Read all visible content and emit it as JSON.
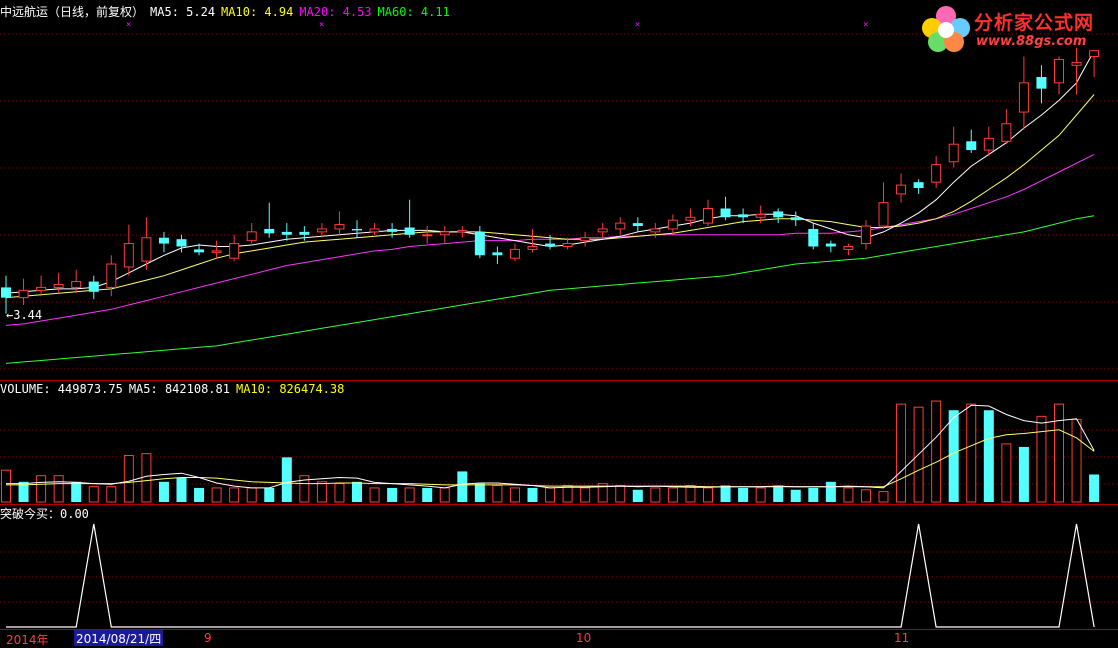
{
  "header": {
    "title": "中远航运（日线，前复权）",
    "ma5": "MA5: 5.24",
    "ma10": "MA10: 4.94",
    "ma20": "MA20: 4.53",
    "ma60": "MA60: 4.11"
  },
  "price_low_marker": "←3.44",
  "volume_header": {
    "volume": "VOLUME: 449873.75",
    "ma5": "MA5: 842108.81",
    "ma10": "MA10: 826474.38"
  },
  "indicator_header": "突破今买：0.00",
  "date_axis": {
    "year": "2014年",
    "selected_date": "2014/08/21/四",
    "month_labels": [
      "9",
      "10",
      "11"
    ]
  },
  "logo": {
    "name": "分析家公式网",
    "url": "www.88gs.com"
  },
  "colors": {
    "up": "#ff3b3b",
    "down": "#54ffff",
    "ma5": "#ffffff",
    "ma10": "#ffff66",
    "ma20": "#ff33ff",
    "ma60": "#33ff33",
    "grid": "#8b0000"
  },
  "chart_data": {
    "type": "candlestick",
    "note_units": "price in CNY, volume in shares",
    "candles": [
      [
        3.62,
        3.55,
        3.7,
        3.44
      ],
      [
        3.55,
        3.6,
        3.68,
        3.5
      ],
      [
        3.6,
        3.62,
        3.7,
        3.56
      ],
      [
        3.62,
        3.64,
        3.72,
        3.58
      ],
      [
        3.62,
        3.66,
        3.74,
        3.58
      ],
      [
        3.66,
        3.59,
        3.7,
        3.54
      ],
      [
        3.62,
        3.78,
        3.84,
        3.56
      ],
      [
        3.76,
        3.92,
        4.05,
        3.7
      ],
      [
        3.8,
        3.96,
        4.1,
        3.74
      ],
      [
        3.96,
        3.92,
        4.0,
        3.86
      ],
      [
        3.95,
        3.9,
        3.98,
        3.86
      ],
      [
        3.88,
        3.86,
        3.92,
        3.84
      ],
      [
        3.86,
        3.87,
        3.94,
        3.82
      ],
      [
        3.82,
        3.92,
        3.98,
        3.8
      ],
      [
        3.94,
        4.0,
        4.06,
        3.92
      ],
      [
        4.02,
        3.99,
        4.2,
        3.96
      ],
      [
        4.0,
        3.98,
        4.06,
        3.94
      ],
      [
        4.0,
        3.98,
        4.04,
        3.94
      ],
      [
        4.0,
        4.02,
        4.06,
        3.96
      ],
      [
        4.02,
        4.05,
        4.14,
        3.98
      ],
      [
        4.02,
        4.01,
        4.08,
        3.96
      ],
      [
        4.0,
        4.02,
        4.06,
        3.98
      ],
      [
        4.02,
        4.0,
        4.06,
        3.96
      ],
      [
        4.03,
        3.98,
        4.22,
        3.96
      ],
      [
        3.98,
        3.98,
        4.04,
        3.92
      ],
      [
        3.98,
        4.0,
        4.04,
        3.92
      ],
      [
        4.0,
        4.01,
        4.04,
        3.96
      ],
      [
        4.0,
        3.84,
        4.04,
        3.82
      ],
      [
        3.86,
        3.84,
        3.9,
        3.78
      ],
      [
        3.82,
        3.88,
        3.92,
        3.8
      ],
      [
        3.88,
        3.9,
        4.02,
        3.86
      ],
      [
        3.92,
        3.9,
        3.98,
        3.88
      ],
      [
        3.9,
        3.92,
        3.96,
        3.88
      ],
      [
        3.94,
        3.96,
        4.0,
        3.9
      ],
      [
        4.0,
        4.02,
        4.06,
        3.96
      ],
      [
        4.02,
        4.06,
        4.1,
        3.98
      ],
      [
        4.06,
        4.04,
        4.1,
        4.0
      ],
      [
        4.0,
        4.02,
        4.06,
        3.96
      ],
      [
        4.02,
        4.08,
        4.12,
        3.98
      ],
      [
        4.08,
        4.1,
        4.16,
        4.04
      ],
      [
        4.06,
        4.16,
        4.22,
        4.04
      ],
      [
        4.16,
        4.1,
        4.24,
        4.08
      ],
      [
        4.12,
        4.1,
        4.16,
        4.06
      ],
      [
        4.1,
        4.12,
        4.18,
        4.06
      ],
      [
        4.14,
        4.1,
        4.16,
        4.06
      ],
      [
        4.1,
        4.08,
        4.14,
        4.04
      ],
      [
        4.02,
        3.9,
        4.06,
        3.88
      ],
      [
        3.92,
        3.9,
        3.94,
        3.86
      ],
      [
        3.88,
        3.9,
        3.92,
        3.84
      ],
      [
        3.92,
        4.04,
        4.08,
        3.88
      ],
      [
        4.04,
        4.2,
        4.34,
        4.02
      ],
      [
        4.26,
        4.32,
        4.4,
        4.2
      ],
      [
        4.34,
        4.3,
        4.36,
        4.26
      ],
      [
        4.34,
        4.46,
        4.52,
        4.3
      ],
      [
        4.48,
        4.6,
        4.72,
        4.44
      ],
      [
        4.62,
        4.56,
        4.7,
        4.54
      ],
      [
        4.56,
        4.64,
        4.72,
        4.52
      ],
      [
        4.62,
        4.74,
        4.84,
        4.6
      ],
      [
        4.82,
        5.02,
        5.2,
        4.7
      ],
      [
        5.06,
        4.98,
        5.14,
        4.88
      ],
      [
        5.02,
        5.18,
        5.2,
        4.94
      ],
      [
        5.14,
        5.16,
        5.26,
        4.94
      ],
      [
        5.2,
        5.24,
        5.24,
        5.06
      ]
    ],
    "ma5": [
      3.58,
      3.59,
      3.6,
      3.61,
      3.61,
      3.62,
      3.66,
      3.72,
      3.78,
      3.84,
      3.89,
      3.91,
      3.9,
      3.9,
      3.91,
      3.93,
      3.95,
      3.96,
      3.97,
      3.98,
      3.99,
      4.0,
      4.01,
      4.01,
      4.01,
      4.0,
      4.0,
      3.98,
      3.96,
      3.94,
      3.92,
      3.9,
      3.91,
      3.93,
      3.95,
      3.97,
      4.0,
      4.02,
      4.04,
      4.06,
      4.09,
      4.11,
      4.11,
      4.12,
      4.12,
      4.11,
      4.06,
      4.02,
      3.98,
      3.96,
      4.0,
      4.06,
      4.13,
      4.22,
      4.34,
      4.45,
      4.53,
      4.61,
      4.71,
      4.8,
      4.9,
      5.02,
      5.24
    ],
    "ma10": [
      3.55,
      3.56,
      3.57,
      3.58,
      3.59,
      3.6,
      3.61,
      3.64,
      3.67,
      3.7,
      3.74,
      3.78,
      3.82,
      3.85,
      3.87,
      3.89,
      3.91,
      3.93,
      3.94,
      3.95,
      3.96,
      3.97,
      3.98,
      3.99,
      4.0,
      4.0,
      4.0,
      4.0,
      3.99,
      3.98,
      3.97,
      3.96,
      3.95,
      3.95,
      3.95,
      3.96,
      3.97,
      3.98,
      3.99,
      4.01,
      4.03,
      4.05,
      4.07,
      4.08,
      4.09,
      4.09,
      4.08,
      4.07,
      4.05,
      4.03,
      4.03,
      4.04,
      4.06,
      4.09,
      4.14,
      4.21,
      4.29,
      4.37,
      4.46,
      4.56,
      4.66,
      4.8,
      4.94
    ],
    "ma20": [
      3.36,
      3.37,
      3.39,
      3.41,
      3.43,
      3.45,
      3.47,
      3.5,
      3.53,
      3.56,
      3.59,
      3.62,
      3.65,
      3.68,
      3.71,
      3.74,
      3.77,
      3.79,
      3.81,
      3.83,
      3.85,
      3.87,
      3.88,
      3.9,
      3.91,
      3.92,
      3.93,
      3.94,
      3.94,
      3.94,
      3.95,
      3.95,
      3.95,
      3.96,
      3.96,
      3.97,
      3.97,
      3.98,
      3.98,
      3.98,
      3.98,
      3.98,
      3.98,
      3.98,
      3.98,
      3.99,
      3.99,
      3.99,
      4.0,
      4.01,
      4.03,
      4.05,
      4.07,
      4.09,
      4.12,
      4.16,
      4.2,
      4.24,
      4.29,
      4.35,
      4.41,
      4.47,
      4.53
    ],
    "ma60": [
      3.1,
      3.11,
      3.12,
      3.13,
      3.14,
      3.15,
      3.16,
      3.17,
      3.18,
      3.19,
      3.2,
      3.21,
      3.22,
      3.24,
      3.26,
      3.28,
      3.3,
      3.32,
      3.34,
      3.36,
      3.38,
      3.4,
      3.42,
      3.44,
      3.46,
      3.48,
      3.5,
      3.52,
      3.54,
      3.56,
      3.58,
      3.6,
      3.61,
      3.62,
      3.63,
      3.64,
      3.65,
      3.66,
      3.67,
      3.68,
      3.69,
      3.7,
      3.72,
      3.74,
      3.76,
      3.78,
      3.79,
      3.8,
      3.81,
      3.82,
      3.84,
      3.86,
      3.88,
      3.9,
      3.92,
      3.94,
      3.96,
      3.98,
      4.0,
      4.03,
      4.06,
      4.09,
      4.11
    ],
    "volume": {
      "values": [
        520000,
        330000,
        430000,
        430000,
        330000,
        250000,
        250000,
        760000,
        790000,
        330000,
        400000,
        230000,
        230000,
        230000,
        230000,
        230000,
        730000,
        430000,
        330000,
        300000,
        330000,
        230000,
        230000,
        230000,
        230000,
        230000,
        500000,
        300000,
        270000,
        230000,
        230000,
        230000,
        270000,
        230000,
        300000,
        270000,
        200000,
        230000,
        230000,
        270000,
        230000,
        270000,
        230000,
        230000,
        270000,
        200000,
        230000,
        330000,
        230000,
        200000,
        170000,
        1600000,
        1550000,
        1650000,
        1500000,
        1600000,
        1500000,
        950000,
        900000,
        1400000,
        1600000,
        1350000,
        449873.75
      ],
      "up": [
        true,
        false,
        true,
        true,
        false,
        true,
        true,
        true,
        true,
        false,
        false,
        false,
        true,
        true,
        true,
        false,
        false,
        true,
        true,
        true,
        false,
        true,
        false,
        true,
        false,
        true,
        false,
        false,
        true,
        true,
        false,
        true,
        true,
        true,
        true,
        true,
        false,
        true,
        true,
        true,
        true,
        false,
        false,
        true,
        false,
        false,
        false,
        false,
        true,
        true,
        true,
        true,
        true,
        true,
        false,
        true,
        false,
        true,
        false,
        true,
        true,
        true,
        false
      ],
      "ma5": [
        300000,
        300000,
        320000,
        330000,
        320000,
        300000,
        290000,
        340000,
        420000,
        450000,
        470000,
        400000,
        310000,
        260000,
        230000,
        230000,
        320000,
        360000,
        380000,
        400000,
        390000,
        320000,
        300000,
        280000,
        260000,
        230000,
        290000,
        310000,
        310000,
        290000,
        270000,
        230000,
        240000,
        240000,
        250000,
        260000,
        250000,
        260000,
        250000,
        240000,
        240000,
        250000,
        250000,
        250000,
        260000,
        250000,
        250000,
        250000,
        260000,
        250000,
        230000,
        500000,
        780000,
        1060000,
        1380000,
        1580000,
        1570000,
        1430000,
        1330000,
        1290000,
        1330000,
        1360000,
        842108.81
      ],
      "ma10": [
        280000,
        280000,
        290000,
        300000,
        300000,
        300000,
        300000,
        320000,
        350000,
        380000,
        400000,
        400000,
        390000,
        360000,
        330000,
        320000,
        310000,
        300000,
        300000,
        310000,
        310000,
        300000,
        300000,
        300000,
        290000,
        280000,
        280000,
        280000,
        280000,
        280000,
        270000,
        260000,
        260000,
        260000,
        260000,
        260000,
        260000,
        260000,
        260000,
        260000,
        250000,
        250000,
        250000,
        250000,
        250000,
        250000,
        250000,
        250000,
        250000,
        250000,
        250000,
        380000,
        520000,
        650000,
        800000,
        920000,
        1040000,
        1100000,
        1120000,
        1150000,
        1180000,
        1050000,
        826474.38
      ]
    },
    "signal": {
      "name": "突破今买",
      "spikes_at": [
        5,
        52,
        61
      ],
      "last": 0.0
    },
    "markers_x_at": [
      7,
      18,
      36,
      49
    ]
  }
}
